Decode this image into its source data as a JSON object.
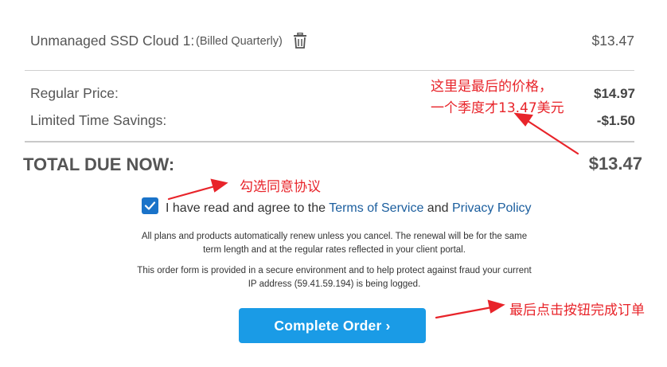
{
  "line_item": {
    "name": "Unmanaged SSD Cloud 1:",
    "billing_cycle": "(Billed Quarterly)",
    "price": "$13.47"
  },
  "summary": {
    "regular_price_label": "Regular Price:",
    "regular_price_value": "$14.97",
    "savings_label": "Limited Time Savings:",
    "savings_value": "-$1.50",
    "total_label": "TOTAL DUE NOW:",
    "total_value": "$13.47"
  },
  "agreement": {
    "checked": true,
    "text_before": "I have read and agree to the ",
    "terms_link": "Terms of Service",
    "text_and": " and ",
    "privacy_link": "Privacy Policy"
  },
  "notices": {
    "renewal_line1": "All plans and products automatically renew unless you cancel. The renewal will be for the same",
    "renewal_line2": "term length and at the regular rates reflected in your client portal.",
    "security_line1": "This order form is provided in a secure environment and to help protect against fraud your current",
    "security_line2": "IP address (59.41.59.194) is being logged."
  },
  "complete_button": {
    "label": "Complete Order ›"
  },
  "annotations": {
    "price_note_line1": "这里是最后的价格，",
    "price_note_line2": "一个季度才13.47美元",
    "checkbox_note": "勾选同意协议",
    "button_note": "最后点击按钮完成订单"
  },
  "colors": {
    "button": "#1a9be6",
    "checkbox": "#1a73c9",
    "link": "#1b5e9e",
    "annotation": "#e8242a"
  },
  "icons": {
    "remove": "trash-icon",
    "check": "check-icon"
  }
}
